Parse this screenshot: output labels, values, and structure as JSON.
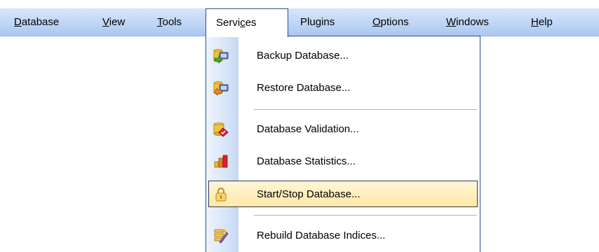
{
  "menubar": {
    "items": [
      {
        "pre": "",
        "u": "D",
        "post": "atabase"
      },
      {
        "pre": "",
        "u": "V",
        "post": "iew"
      },
      {
        "pre": "",
        "u": "T",
        "post": "ools"
      },
      {
        "pre": "Servi",
        "u": "c",
        "post": "es"
      },
      {
        "pre": "Plu",
        "u": "g",
        "post": "ins"
      },
      {
        "pre": "",
        "u": "O",
        "post": "ptions"
      },
      {
        "pre": "",
        "u": "W",
        "post": "indows"
      },
      {
        "pre": "",
        "u": "H",
        "post": "elp"
      }
    ],
    "active_item": "Services"
  },
  "services_menu": {
    "items": [
      {
        "label": "Backup Database...",
        "icon": "backup-database-icon"
      },
      {
        "label": "Restore Database...",
        "icon": "restore-database-icon"
      },
      {
        "label": "Database Validation...",
        "icon": "database-validation-icon"
      },
      {
        "label": "Database Statistics...",
        "icon": "database-statistics-icon"
      },
      {
        "label": "Start/Stop Database...",
        "icon": "start-stop-database-icon",
        "highlighted": true
      },
      {
        "label": "Rebuild Database Indices...",
        "icon": "rebuild-indices-icon"
      }
    ]
  },
  "colors": {
    "menubar_top": "#d7e6fa",
    "menubar_bottom": "#a9c6ef",
    "menu_border": "#2b4f8a",
    "highlight_top": "#fff6d9",
    "highlight_bottom": "#ffe7a6"
  }
}
